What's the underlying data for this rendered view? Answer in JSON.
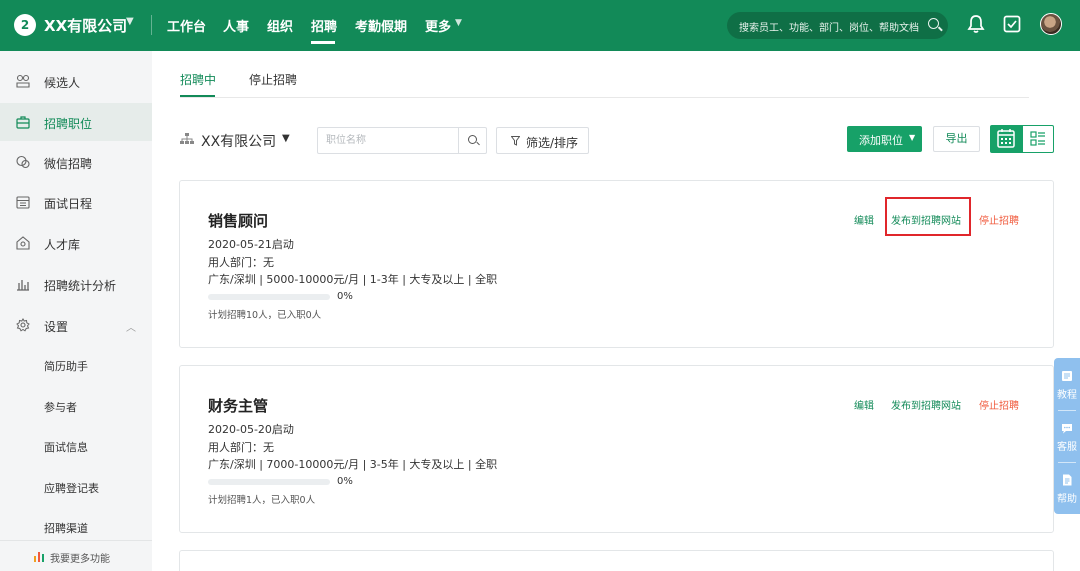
{
  "header": {
    "logo_text": "2",
    "company": "XX有限公司",
    "nav": [
      "工作台",
      "人事",
      "组织",
      "招聘",
      "考勤假期",
      "更多"
    ],
    "active_nav": "招聘",
    "search_placeholder": "搜索员工、功能、部门、岗位、帮助文档",
    "brand_color": "#128a58"
  },
  "sidebar": {
    "items": [
      {
        "label": "候选人",
        "icon": "candidate-icon"
      },
      {
        "label": "招聘职位",
        "icon": "briefcase-icon",
        "active": true
      },
      {
        "label": "微信招聘",
        "icon": "wechat-icon"
      },
      {
        "label": "面试日程",
        "icon": "calendar-icon"
      },
      {
        "label": "人才库",
        "icon": "talent-pool-icon"
      },
      {
        "label": "招聘统计分析",
        "icon": "bar-chart-icon"
      },
      {
        "label": "设置",
        "icon": "gear-icon"
      }
    ],
    "sub_items": [
      "简历助手",
      "参与者",
      "面试信息",
      "应聘登记表",
      "招聘渠道"
    ],
    "footer": "我要更多功能"
  },
  "tabs": [
    "招聘中",
    "停止招聘"
  ],
  "toolbar": {
    "org": "XX有限公司",
    "position_placeholder": "职位名称",
    "filter_label": "筛选/排序",
    "add_label": "添加职位",
    "export_label": "导出"
  },
  "jobs": [
    {
      "title": "销售顾问",
      "date": "2020-05-21启动",
      "dept": "用人部门：无",
      "details": "广东/深圳 | 5000-10000元/月 | 1-3年 | 大专及以上 | 全职",
      "progress": 0,
      "progress_text": "0%",
      "plan": "计划招聘10人，已入职0人",
      "actions": [
        "编辑",
        "发布到招聘网站",
        "停止招聘"
      ]
    },
    {
      "title": "财务主管",
      "date": "2020-05-20启动",
      "dept": "用人部门：无",
      "details": "广东/深圳 | 7000-10000元/月 | 3-5年 | 大专及以上 | 全职",
      "progress": 0,
      "progress_text": "0%",
      "plan": "计划招聘1人，已入职0人",
      "actions": [
        "编辑",
        "发布到招聘网站",
        "停止招聘"
      ]
    }
  ],
  "float_panel": [
    "教程",
    "客服",
    "帮助"
  ]
}
